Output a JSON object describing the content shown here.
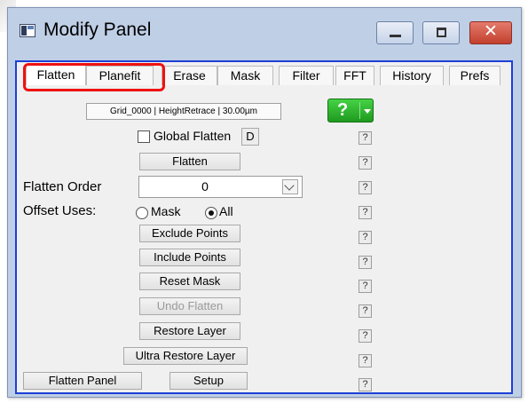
{
  "window": {
    "title": "Modify Panel"
  },
  "tabs": [
    "Flatten",
    "Planefit",
    "Erase",
    "Mask",
    "Filter",
    "FFT",
    "History",
    "Prefs"
  ],
  "active_tab": "Flatten",
  "info_box": "Grid_0000  |  HeightRetrace  |  30.00µm",
  "help_button": "?",
  "global_flatten": {
    "label": "Global Flatten",
    "checked": false,
    "d_button": "D"
  },
  "buttons": {
    "flatten": "Flatten",
    "exclude_points": "Exclude Points",
    "include_points": "Include Points",
    "reset_mask": "Reset Mask",
    "undo_flatten": "Undo Flatten",
    "restore_layer": "Restore Layer",
    "ultra_restore_layer": "Ultra Restore Layer",
    "flatten_panel": "Flatten Panel",
    "setup": "Setup"
  },
  "flatten_order": {
    "label": "Flatten Order",
    "value": "0"
  },
  "offset_uses": {
    "label": "Offset Uses:",
    "options": [
      "Mask",
      "All"
    ],
    "selected": "All"
  },
  "question_mark": "?",
  "colors": {
    "panel_border": "#1d3fd6",
    "highlight": "#ee1212",
    "help_green": "#2fb62f"
  }
}
